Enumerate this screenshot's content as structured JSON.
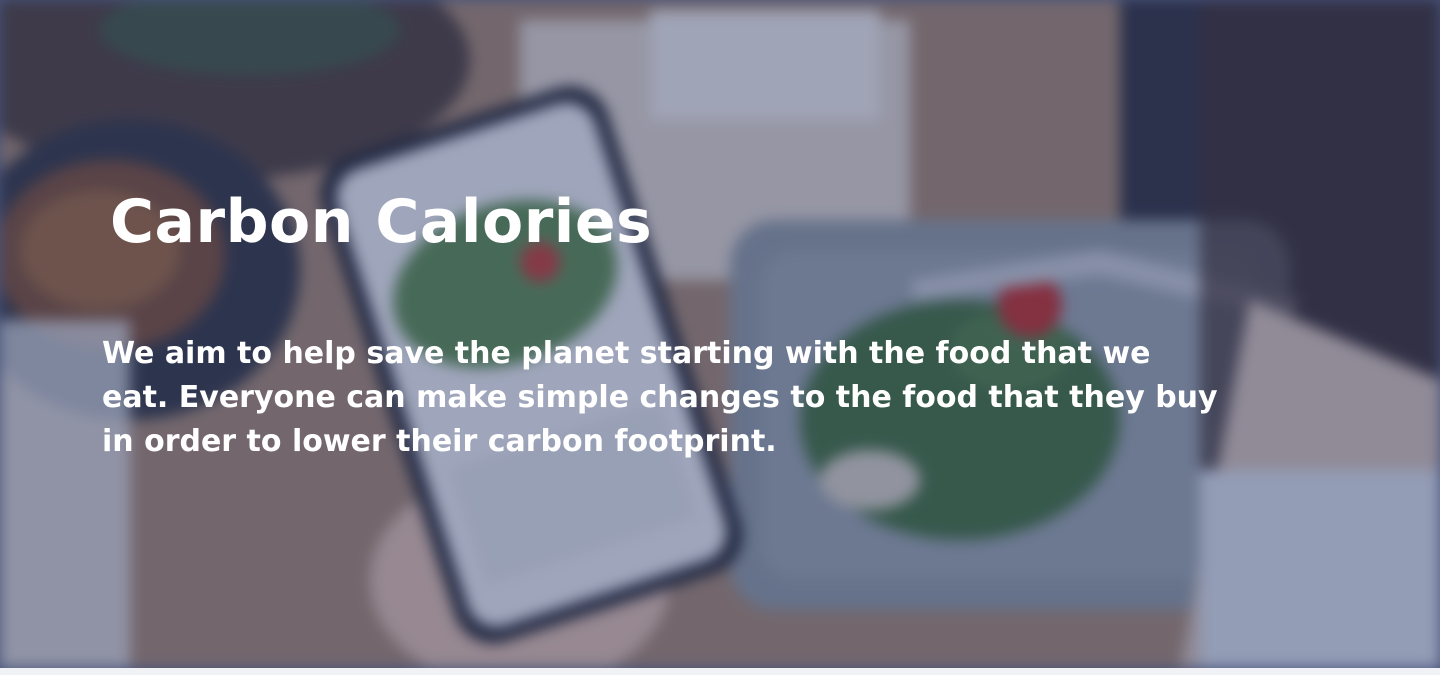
{
  "hero": {
    "title": "Carbon Calories",
    "description": "We aim to help save the planet starting with the food that we eat. Everyone can make simple changes to the food that they buy in order to lower their carbon footprint.",
    "background_image": "blurred-photo-person-using-diet-tracker-app-over-salad",
    "overlay_color": "#2e3c6e",
    "text_color": "#ffffff"
  }
}
